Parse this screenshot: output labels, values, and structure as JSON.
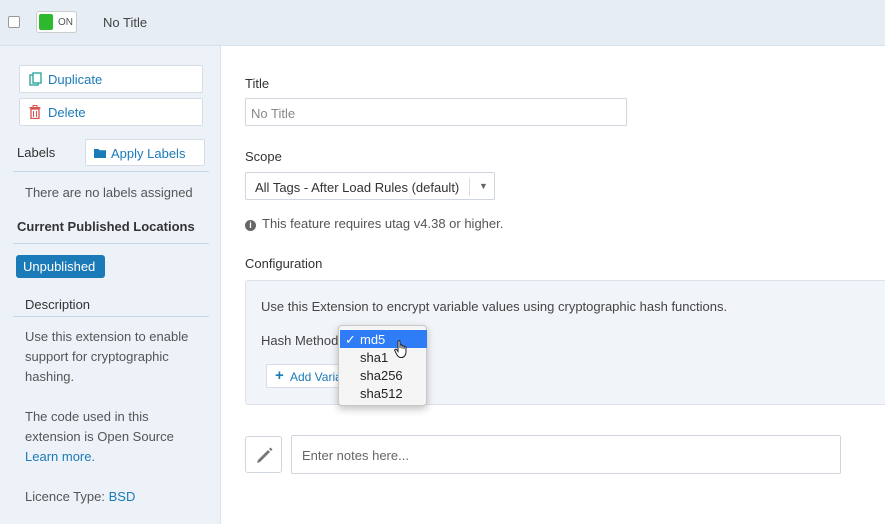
{
  "header": {
    "toggle_label": "ON",
    "title": "No Title"
  },
  "sidebar": {
    "duplicate_label": "Duplicate",
    "delete_label": "Delete",
    "labels_title": "Labels",
    "apply_labels": "Apply Labels",
    "no_labels": "There are no labels assigned",
    "published_title": "Current Published Locations",
    "status_badge": "Unpublished",
    "description_title": "Description",
    "description_text": "Use this extension to enable support for cryptographic hashing.",
    "source_text": "The code used in this extension is Open Source",
    "learn_more": "Learn more.",
    "licence_label": "Licence Type:",
    "licence_value": "BSD"
  },
  "main": {
    "title_label": "Title",
    "title_placeholder": "No Title",
    "scope_label": "Scope",
    "scope_value": "All Tags - After Load Rules (default)",
    "info_text": "This feature requires utag v4.38 or higher.",
    "config_label": "Configuration",
    "config_intro": "Use this Extension to encrypt variable values using cryptographic hash functions.",
    "hash_method_label": "Hash Method",
    "add_variable": "Add Variable",
    "notes_placeholder": "Enter notes here..."
  },
  "hash_dropdown": {
    "selected": "md5",
    "options": [
      "md5",
      "sha1",
      "sha256",
      "sha512"
    ]
  },
  "colors": {
    "accent": "#1b7ab8",
    "toggle_on": "#2eb82e",
    "selection": "#2e7cf6"
  }
}
